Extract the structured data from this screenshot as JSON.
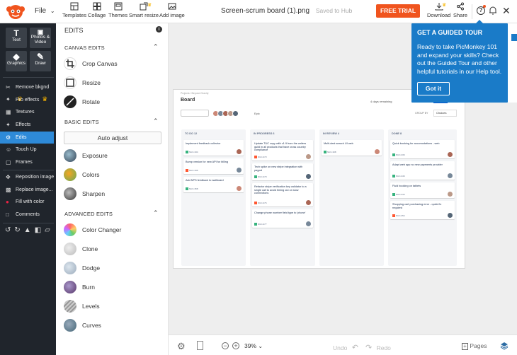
{
  "header": {
    "file_label": "File",
    "tools": [
      {
        "label": "Templates",
        "icon": "templates-icon"
      },
      {
        "label": "Collage",
        "icon": "collage-icon"
      },
      {
        "label": "Themes",
        "icon": "themes-icon"
      },
      {
        "label": "Smart resize",
        "icon": "smart-resize-icon",
        "premium": true
      },
      {
        "label": "Add image",
        "icon": "add-image-icon"
      }
    ],
    "doc_title": "Screen-scrum board (1).png",
    "save_status": "Saved to Hub",
    "free_trial": "FREE TRIAL",
    "download": "Download",
    "share": "Share"
  },
  "rail": {
    "tiles": [
      {
        "label": "Text",
        "glyph": "T"
      },
      {
        "label": "Photos & Video",
        "glyph": "▣"
      },
      {
        "label": "Graphics",
        "glyph": "◆"
      },
      {
        "label": "Draw",
        "glyph": "✎"
      }
    ],
    "items": [
      {
        "label": "Remove bkgnd",
        "icon": "remove-background-icon",
        "premium": true
      },
      {
        "label": "Pro effects",
        "icon": "pro-effects-icon",
        "premium": true
      },
      {
        "label": "Textures",
        "icon": "textures-icon"
      },
      {
        "label": "Effects",
        "icon": "effects-icon"
      },
      {
        "label": "Edits",
        "icon": "edits-icon",
        "active": true
      },
      {
        "label": "Touch Up",
        "icon": "touch-up-icon"
      },
      {
        "label": "Frames",
        "icon": "frames-icon"
      },
      {
        "label": "Reposition image",
        "icon": "reposition-icon"
      },
      {
        "label": "Replace image...",
        "icon": "replace-image-icon"
      },
      {
        "label": "Fill with color",
        "icon": "fill-color-icon"
      },
      {
        "label": "Comments",
        "icon": "comments-icon"
      }
    ]
  },
  "panel": {
    "title": "EDITS",
    "canvas_heading": "CANVAS EDITS",
    "canvas_items": [
      "Crop Canvas",
      "Resize",
      "Rotate"
    ],
    "basic_heading": "BASIC EDITS",
    "auto_adjust": "Auto adjust",
    "basic_items": [
      "Exposure",
      "Colors",
      "Sharpen"
    ],
    "advanced_heading": "ADVANCED EDITS",
    "advanced_items": [
      "Color Changer",
      "Clone",
      "Dodge",
      "Burn",
      "Levels",
      "Curves"
    ]
  },
  "bottom": {
    "zoom": "39%",
    "undo": "Undo",
    "redo": "Redo",
    "pages": "Pages"
  },
  "tour": {
    "title": "GET A GUIDED TOUR",
    "body": "Ready to take PicMonkey 101 and expand your skills? Check out the Guided Tour and other helpful tutorials in our Help tool.",
    "button": "Got it"
  },
  "board": {
    "breadcrumb": "Projects / Beyond Gravity",
    "title": "Board",
    "remaining": "4 days remaining",
    "epic": "Epic",
    "group_by": "GROUP BY",
    "choices": "Choices",
    "columns": [
      {
        "header": "TO DO  12",
        "cards": [
          {
            "text": "Implement feedback collector",
            "id": "NUC-334"
          },
          {
            "text": "Bump version for new API for billing",
            "id": "NUC-336"
          },
          {
            "text": "Add NPS feedback to wallboard",
            "id": "NUC-358"
          }
        ]
      },
      {
        "header": "IN PROGRESS  6",
        "cards": [
          {
            "text": "Update T&C copy with v1.9 from the writers guild in all products that have cross country compliance",
            "id": "NUC-373"
          },
          {
            "text": "Tech spike on new stripe integration with paypal",
            "id": "NUC-370"
          },
          {
            "text": "Refactor stripe verification key validator to a single call to avoid timing out on slow connections",
            "id": "NUC-376"
          },
          {
            "text": "Change phone number field type to 'phone'",
            "id": "NUC-377"
          }
        ]
      },
      {
        "header": "IN REVIEW  4",
        "cards": [
          {
            "text": "Multi-dest search UI web",
            "id": "NUC-338"
          }
        ]
      },
      {
        "header": "DONE  8",
        "cards": [
          {
            "text": "Quick booking for accomodations - web",
            "id": "NUC-336"
          },
          {
            "text": "Adapt web app no new payments provider",
            "id": "NUC-346"
          },
          {
            "text": "Fluid booking on tablets",
            "id": "NUC-343"
          },
          {
            "text": "Shopping cart purchasing error - quick fix required",
            "id": "NUC-354"
          }
        ]
      }
    ]
  }
}
